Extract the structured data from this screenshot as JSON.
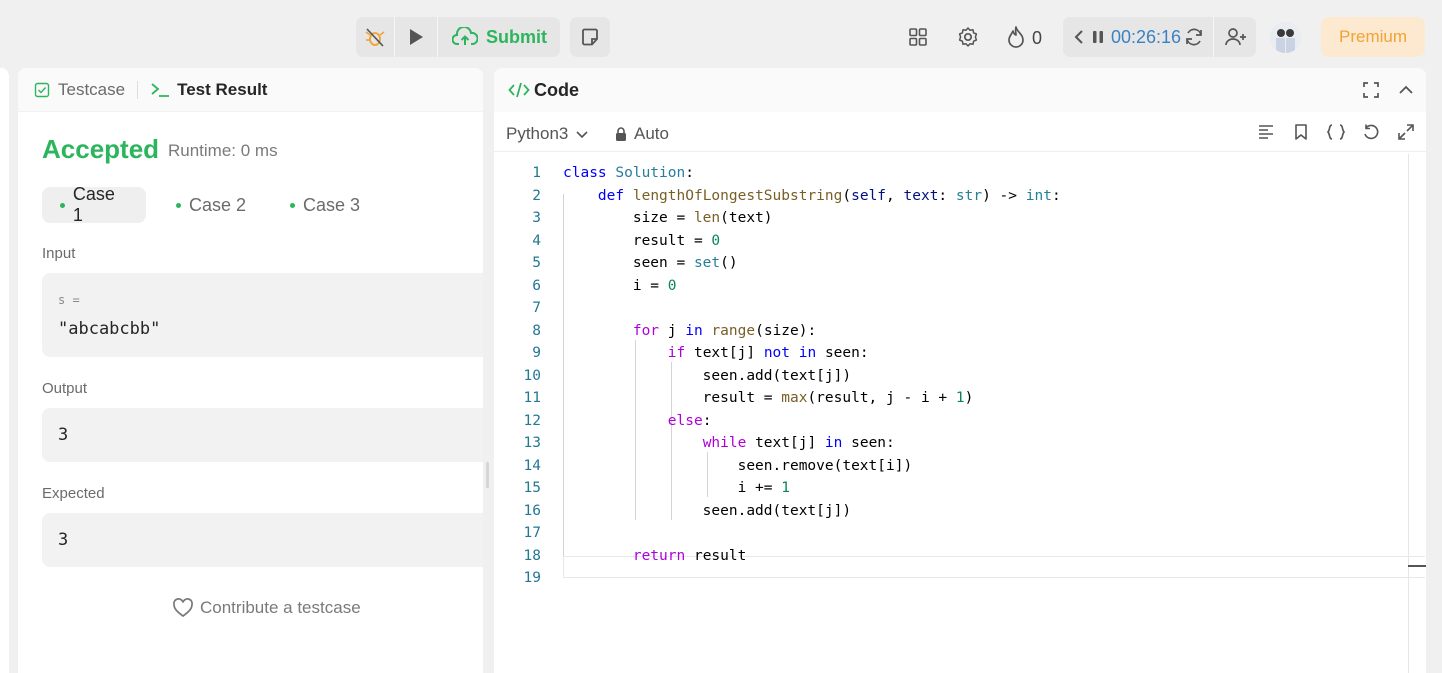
{
  "topbar": {
    "submit_label": "Submit",
    "streak_count": "0",
    "timer": "00:26:16",
    "premium_label": "Premium"
  },
  "left_panel": {
    "tabs": [
      {
        "label": "Testcase"
      },
      {
        "label": "Test Result"
      }
    ],
    "status": "Accepted",
    "runtime": "Runtime: 0 ms",
    "cases": [
      "Case 1",
      "Case 2",
      "Case 3"
    ],
    "input_label": "Input",
    "input_var": "s =",
    "input_value": "\"abcabcbb\"",
    "output_label": "Output",
    "output_value": "3",
    "expected_label": "Expected",
    "expected_value": "3",
    "contribute_label": "Contribute a testcase"
  },
  "editor": {
    "title": "Code",
    "language": "Python3",
    "mode": "Auto",
    "line_numbers": [
      "1",
      "2",
      "3",
      "4",
      "5",
      "6",
      "7",
      "8",
      "9",
      "10",
      "11",
      "12",
      "13",
      "14",
      "15",
      "16",
      "17",
      "18",
      "19"
    ]
  },
  "colors": {
    "accent_green": "#2db55d",
    "timer_blue": "#3b82c4",
    "premium_orange": "#f0a336"
  }
}
